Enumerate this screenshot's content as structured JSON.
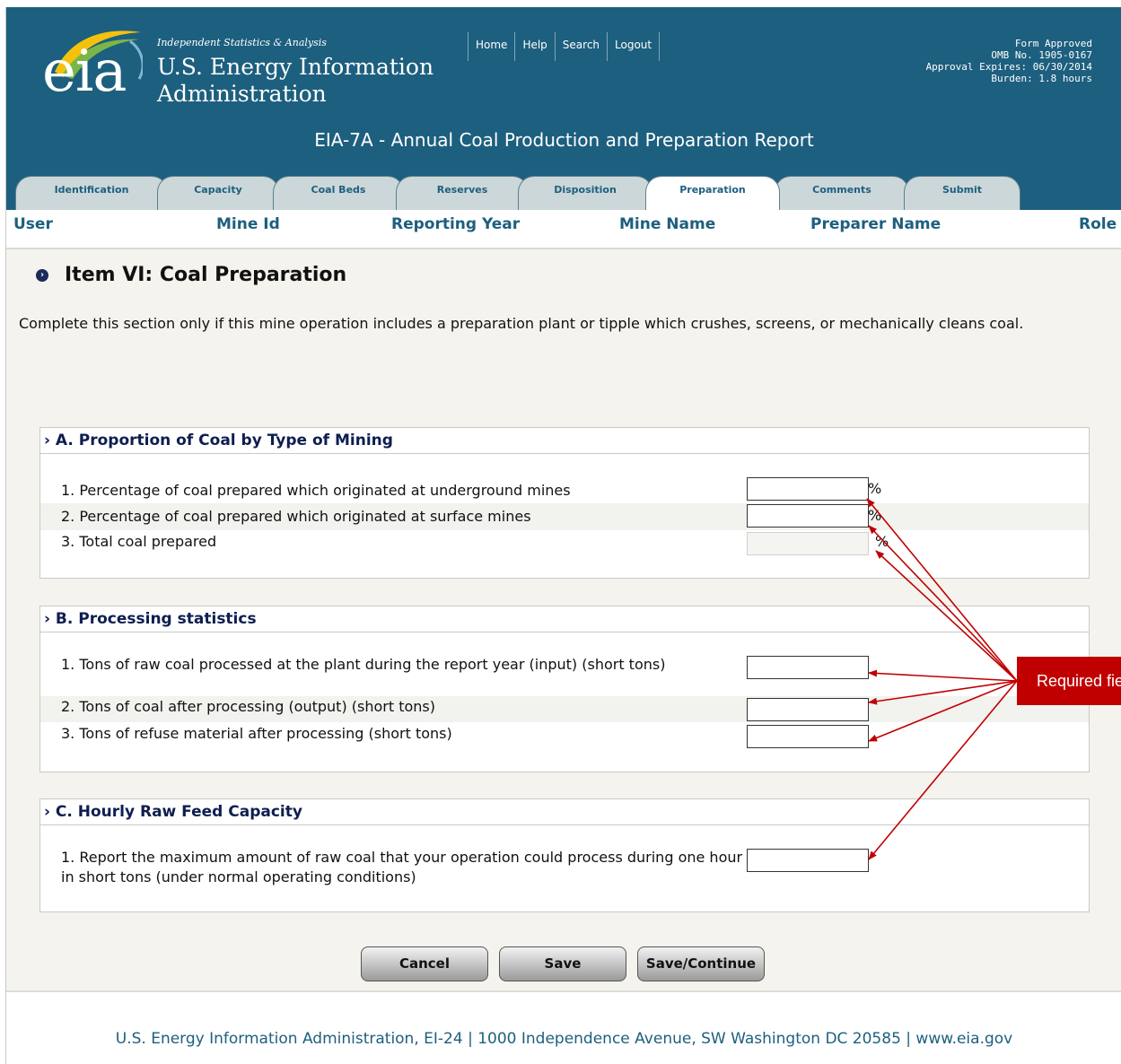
{
  "header": {
    "tagline": "Independent Statistics & Analysis",
    "logo_text": "eia",
    "org_name_line1": "U.S. Energy Information",
    "org_name_line2": "Administration",
    "nav": [
      "Home",
      "Help",
      "Search",
      "Logout"
    ],
    "approval": [
      "Form Approved",
      "OMB No. 1905-0167",
      "Approval Expires: 06/30/2014",
      "Burden: 1.8 hours"
    ],
    "form_title": "EIA-7A - Annual Coal Production and Preparation Report",
    "brand_color": "#1d5f7e"
  },
  "tabs": [
    {
      "label": "Identification",
      "active": false
    },
    {
      "label": "Capacity",
      "active": false
    },
    {
      "label": "Coal Beds",
      "active": false
    },
    {
      "label": "Reserves",
      "active": false
    },
    {
      "label": "Disposition",
      "active": false
    },
    {
      "label": "Preparation",
      "active": true
    },
    {
      "label": "Comments",
      "active": false
    },
    {
      "label": "Submit",
      "active": false
    }
  ],
  "user_row": {
    "user": "User",
    "mine_id": "Mine Id",
    "reporting_year": "Reporting Year",
    "mine_name": "Mine Name",
    "preparer_name": "Preparer Name",
    "role": "Role"
  },
  "item_title": "Item VI: Coal Preparation",
  "intro": "Complete this section only if this mine operation includes a preparation plant or tipple which crushes, screens, or mechanically cleans coal.",
  "section_a": {
    "title": "› A. Proportion of Coal by Type of Mining",
    "rows": [
      {
        "label": "1. Percentage of coal prepared which originated at underground mines",
        "value": "",
        "unit": "%"
      },
      {
        "label": "2. Percentage of coal prepared which originated at surface mines",
        "value": "",
        "unit": "%"
      },
      {
        "label": "3. Total coal prepared",
        "value": "",
        "unit": "%"
      }
    ]
  },
  "section_b": {
    "title": "› B. Processing statistics",
    "rows": [
      {
        "label": "1. Tons of raw coal processed at the plant during the report year (input) (short tons)",
        "value": ""
      },
      {
        "label": "2. Tons of coal after processing (output) (short tons)",
        "value": ""
      },
      {
        "label": "3. Tons of refuse material after processing (short tons)",
        "value": ""
      }
    ]
  },
  "section_c": {
    "title": "› C. Hourly Raw Feed Capacity",
    "rows": [
      {
        "label": "1. Report the maximum amount of raw coal that your operation could process during one hour in short tons (under normal operating conditions)",
        "value": ""
      }
    ]
  },
  "buttons": {
    "cancel": "Cancel",
    "save": "Save",
    "save_continue": "Save/Continue"
  },
  "footer": "U.S. Energy Information Administration, EI-24 | 1000 Independence Avenue, SW Washington DC 20585  | www.eia.gov",
  "callout": {
    "text": "Required fields",
    "color": "#c00000"
  }
}
